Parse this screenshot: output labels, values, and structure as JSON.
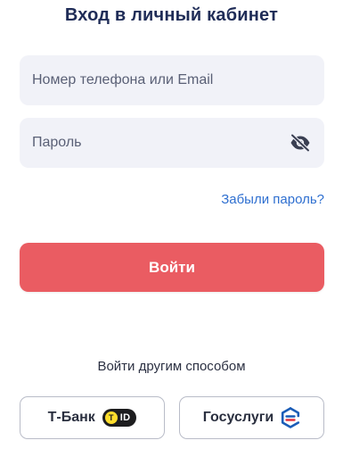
{
  "header": {
    "title": "Вход в личный кабинет"
  },
  "form": {
    "login_placeholder": "Номер телефона или Email",
    "login_value": "",
    "password_placeholder": "Пароль",
    "password_value": "",
    "password_toggle_icon": "eye-off-icon",
    "forgot_label": "Забыли пароль?",
    "submit_label": "Войти"
  },
  "alternatives": {
    "caption": "Войти другим способом",
    "buttons": [
      {
        "label": "Т-Банк",
        "badge_text": "ID",
        "badge_letter": "T",
        "icon": "tbank-id-icon"
      },
      {
        "label": "Госуслуги",
        "icon": "gosuslugi-icon"
      }
    ]
  },
  "colors": {
    "title": "#1f2c57",
    "field_bg": "#f1f2f8",
    "link": "#2e6fd0",
    "submit_bg": "#ea5c62",
    "tid_yellow": "#ffdd2d",
    "gosuslugi_blue": "#1b5db7",
    "gosuslugi_red": "#e2343f"
  }
}
